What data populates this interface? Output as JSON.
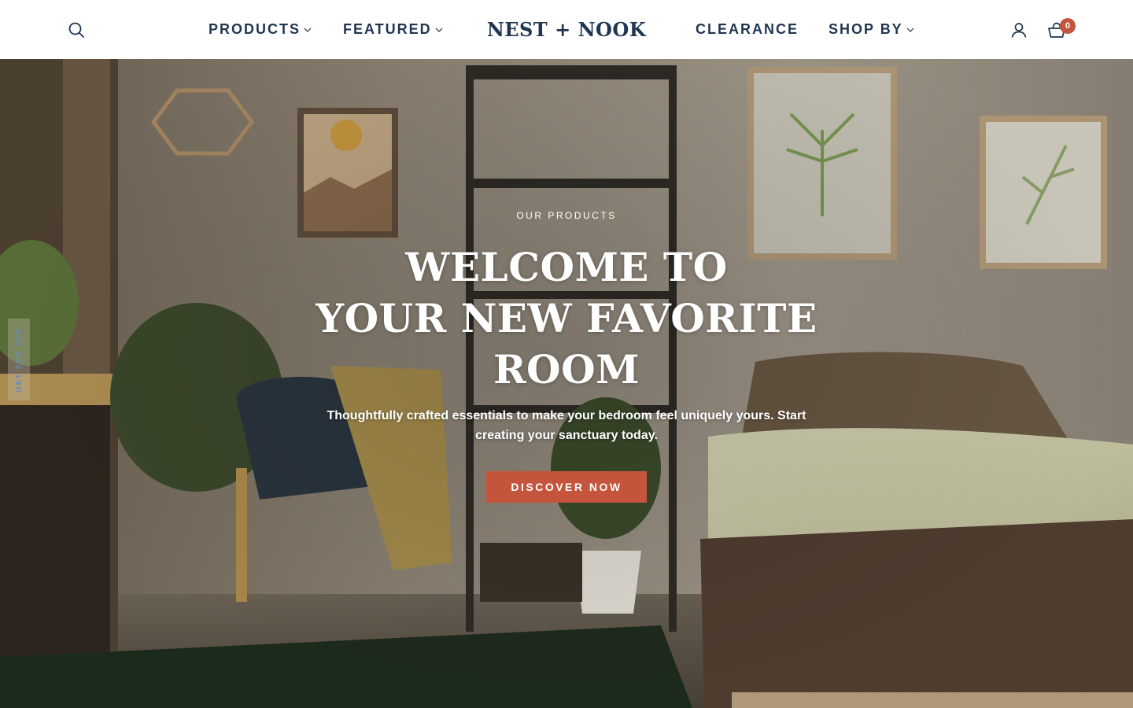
{
  "brand": {
    "name": "NEST + NOOK",
    "color": "#1f3550",
    "accent": "#c4553c"
  },
  "nav": {
    "search_icon": "search-icon",
    "left": [
      {
        "label": "PRODUCTS",
        "has_dropdown": true
      },
      {
        "label": "FEATURED",
        "has_dropdown": true
      }
    ],
    "right": [
      {
        "label": "CLEARANCE",
        "has_dropdown": false
      },
      {
        "label": "SHOP BY",
        "has_dropdown": true
      }
    ],
    "account_icon": "user-icon",
    "cart_icon": "shopping-basket-icon",
    "cart_count": "0"
  },
  "hero": {
    "eyebrow": "OUR PRODUCTS",
    "title_lines": [
      "WELCOME TO",
      "YOUR NEW FAVORITE",
      "ROOM"
    ],
    "subtitle": "Thoughtfully crafted essentials to make your bedroom feel uniquely yours. Start creating your sanctuary today.",
    "cta_label": "DISCOVER NOW"
  },
  "side_tab": {
    "label": "GET 20% OFF"
  }
}
